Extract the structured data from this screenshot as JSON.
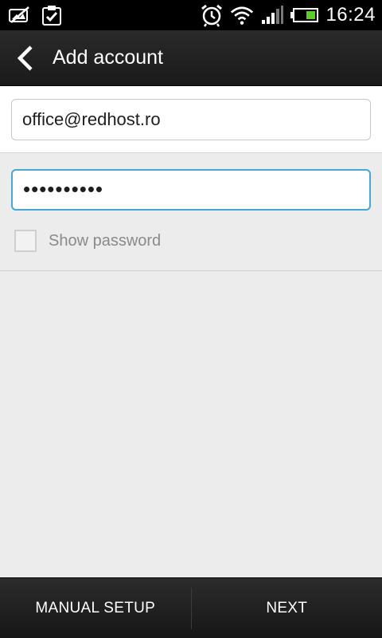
{
  "status_bar": {
    "icons_left": [
      "picture-crossed-icon",
      "clipboard-check-icon"
    ],
    "icons_right": [
      "alarm-clock-icon",
      "wifi-icon",
      "signal-bars-icon",
      "battery-icon"
    ],
    "time": "16:24",
    "accent_color": "#5ccc2b"
  },
  "action_bar": {
    "title": "Add account",
    "back_icon": "chevron-left-icon"
  },
  "form": {
    "email_value": "office@redhost.ro",
    "password_value": "••••••••••",
    "show_password_label": "Show password",
    "show_password_checked": false,
    "focus_color": "#49a6d3"
  },
  "bottom_bar": {
    "manual_setup_label": "MANUAL SETUP",
    "next_label": "NEXT"
  }
}
